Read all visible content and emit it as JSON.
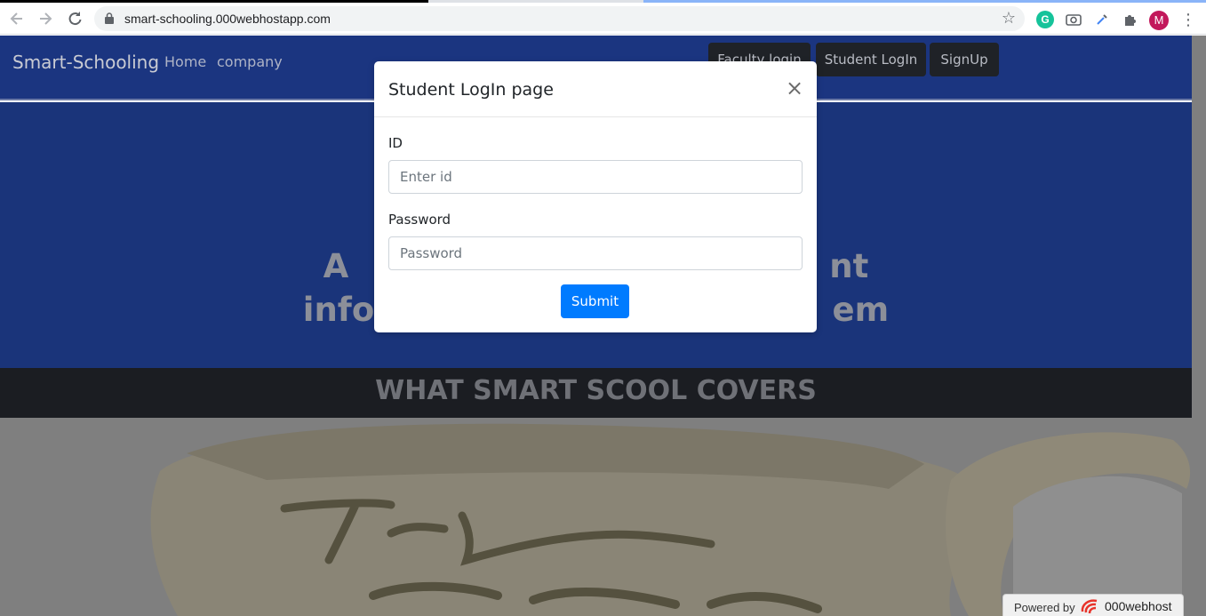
{
  "browser": {
    "url": "smart-schooling.000webhostapp.com",
    "avatar_letter": "M",
    "extension_g": "G"
  },
  "navbar": {
    "brand": "Smart-Schooling",
    "links": [
      "Home",
      "company"
    ],
    "buttons": {
      "faculty": "Faculty login",
      "student": "Student LogIn",
      "signup": "SignUp"
    }
  },
  "hero": {
    "line1": "A                                          nt",
    "line2": "info                                        em"
  },
  "covers": {
    "title": "WHAT SMART SCOOL COVERS"
  },
  "modal": {
    "title": "Student LogIn page",
    "close": "×",
    "id_label": "ID",
    "id_placeholder": "Enter id",
    "password_label": "Password",
    "password_placeholder": "Password",
    "submit": "Submit"
  },
  "footer": {
    "powered_by": "Powered by",
    "host": "000webhost"
  },
  "colors": {
    "navbar": "#1b3580",
    "hero": "#1a347a",
    "primary_button": "#007bff",
    "dark_button": "#1f2227"
  }
}
